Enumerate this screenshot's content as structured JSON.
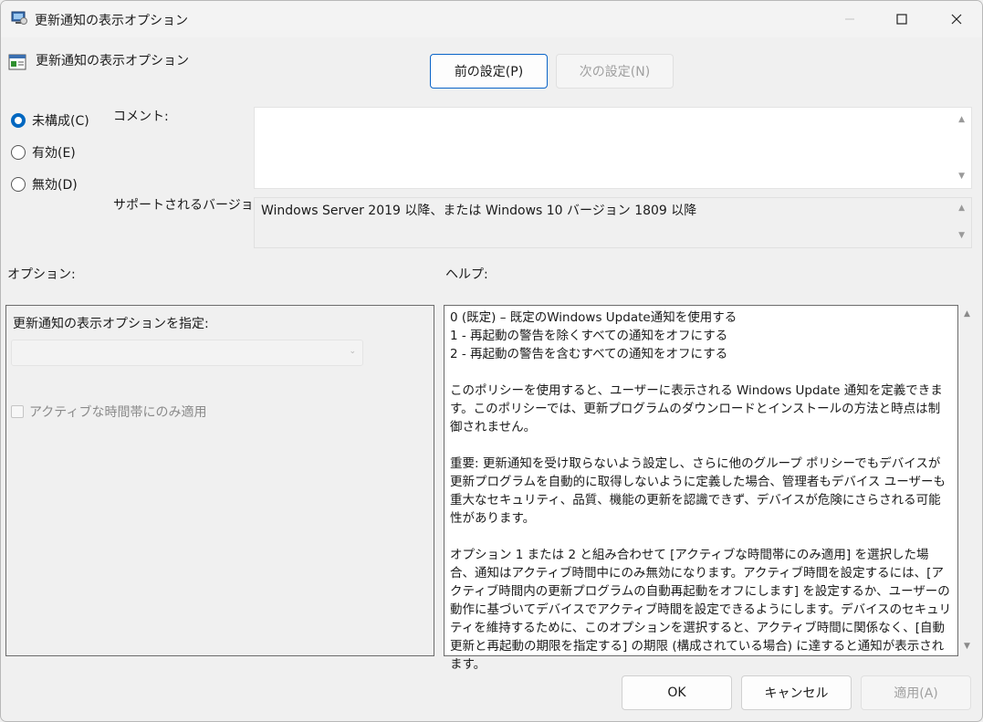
{
  "window": {
    "title": "更新通知の表示オプション"
  },
  "policy_header": "更新通知の表示オプション",
  "nav": {
    "prev_label": "前の設定(P)",
    "next_label": "次の設定(N)"
  },
  "state": {
    "not_configured": "未構成(C)",
    "enabled": "有効(E)",
    "disabled": "無効(D)",
    "selected": "not_configured"
  },
  "comment": {
    "label": "コメント:",
    "value": ""
  },
  "supported": {
    "label": "サポートされるバージョン:",
    "value": "Windows Server 2019 以降、または Windows 10 バージョン 1809 以降"
  },
  "options": {
    "section_label": "オプション:",
    "dropdown_label": "更新通知の表示オプションを指定:",
    "dropdown_value": "",
    "checkbox_label": "アクティブな時間帯にのみ適用"
  },
  "help": {
    "section_label": "ヘルプ:",
    "paragraphs": [
      "0 (既定) – 既定のWindows Update通知を使用する\n1 - 再起動の警告を除くすべての通知をオフにする\n2 - 再起動の警告を含むすべての通知をオフにする",
      "このポリシーを使用すると、ユーザーに表示される Windows Update 通知を定義できます。このポリシーでは、更新プログラムのダウンロードとインストールの方法と時点は制御されません。",
      "重要: 更新通知を受け取らないよう設定し、さらに他のグループ ポリシーでもデバイスが更新プログラムを自動的に取得しないように定義した場合、管理者もデバイス ユーザーも重大なセキュリティ、品質、機能の更新を認識できず、デバイスが危険にさらされる可能性があります。",
      "オプション 1 または 2 と組み合わせて [アクティブな時間帯にのみ適用] を選択した場合、通知はアクティブ時間中にのみ無効になります。アクティブ時間を設定するには、[アクティブ時間内の更新プログラムの自動再起動をオフにします] を設定するか、ユーザーの動作に基づいてデバイスでアクティブ時間を設定できるようにします。デバイスのセキュリティを維持するために、このオプションを選択すると、アクティブ時間に関係なく、[自動更新と再起動の期限を指定する] の期限 (構成されている場合) に達すると通知が表示されます。"
    ]
  },
  "footer": {
    "ok_label": "OK",
    "cancel_label": "キャンセル",
    "apply_label": "適用(A)"
  },
  "colors": {
    "accent": "#0067c0",
    "window_bg": "#f0f0f0",
    "disabled_text": "#a0a0a0"
  }
}
